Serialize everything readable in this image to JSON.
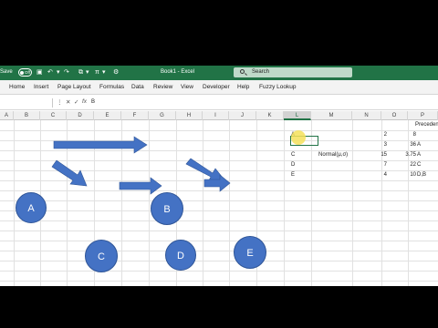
{
  "titlebar": {
    "autosave_label": "Save",
    "autosave_state": "Off",
    "document_title": "Book1 - Excel",
    "search_placeholder": "Search"
  },
  "ribbon": {
    "tabs": [
      "Home",
      "Insert",
      "Page Layout",
      "Formulas",
      "Data",
      "Review",
      "View",
      "Developer",
      "Help",
      "Fuzzy Lookup"
    ]
  },
  "formula_bar": {
    "content": "B"
  },
  "columns": [
    "A",
    "B",
    "C",
    "D",
    "E",
    "F",
    "G",
    "H",
    "I",
    "J",
    "K",
    "L",
    "M",
    "N",
    "O",
    "P"
  ],
  "active_column": "L",
  "header_label": "Preceden",
  "table": [
    {
      "label": "A",
      "value1": "2",
      "value2": "8",
      "pred": ""
    },
    {
      "label": "",
      "value1": "3",
      "value2": "36",
      "pred": "A"
    },
    {
      "label": "C",
      "value1": "15",
      "value2": "3.75",
      "pred": "A"
    },
    {
      "label": "D",
      "value1": "7",
      "value2": "22",
      "pred": "C"
    },
    {
      "label": "E",
      "value1": "4",
      "value2": "10",
      "pred": "D,B"
    }
  ],
  "distribution_label": "Normal(μ,σ)",
  "diagram": {
    "nodes": [
      "A",
      "B",
      "C",
      "D",
      "E"
    ],
    "node_color": "#4472c4"
  },
  "colors": {
    "excel_green": "#217346",
    "cursor_highlight": "#f5e15a"
  }
}
